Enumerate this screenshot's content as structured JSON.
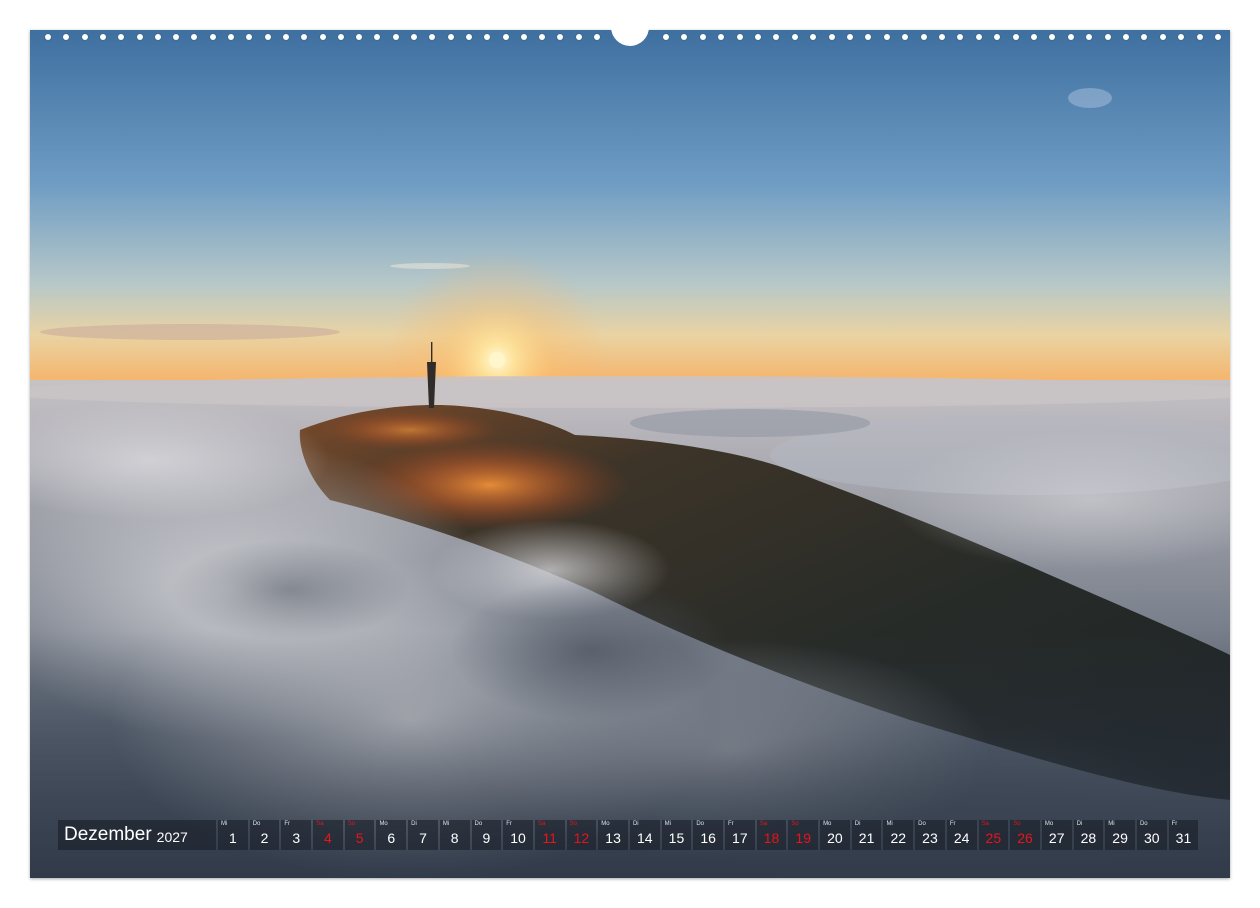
{
  "calendar": {
    "month": "Dezember",
    "year": "2027",
    "days": [
      {
        "weekday": "Mi",
        "date": "1",
        "holiday": false
      },
      {
        "weekday": "Do",
        "date": "2",
        "holiday": false
      },
      {
        "weekday": "Fr",
        "date": "3",
        "holiday": false
      },
      {
        "weekday": "Sa",
        "date": "4",
        "holiday": true
      },
      {
        "weekday": "So",
        "date": "5",
        "holiday": true
      },
      {
        "weekday": "Mo",
        "date": "6",
        "holiday": false
      },
      {
        "weekday": "Di",
        "date": "7",
        "holiday": false
      },
      {
        "weekday": "Mi",
        "date": "8",
        "holiday": false
      },
      {
        "weekday": "Do",
        "date": "9",
        "holiday": false
      },
      {
        "weekday": "Fr",
        "date": "10",
        "holiday": false
      },
      {
        "weekday": "Sa",
        "date": "11",
        "holiday": true
      },
      {
        "weekday": "So",
        "date": "12",
        "holiday": true
      },
      {
        "weekday": "Mo",
        "date": "13",
        "holiday": false
      },
      {
        "weekday": "Di",
        "date": "14",
        "holiday": false
      },
      {
        "weekday": "Mi",
        "date": "15",
        "holiday": false
      },
      {
        "weekday": "Do",
        "date": "16",
        "holiday": false
      },
      {
        "weekday": "Fr",
        "date": "17",
        "holiday": false
      },
      {
        "weekday": "Sa",
        "date": "18",
        "holiday": true
      },
      {
        "weekday": "So",
        "date": "19",
        "holiday": true
      },
      {
        "weekday": "Mo",
        "date": "20",
        "holiday": false
      },
      {
        "weekday": "Di",
        "date": "21",
        "holiday": false
      },
      {
        "weekday": "Mi",
        "date": "22",
        "holiday": false
      },
      {
        "weekday": "Do",
        "date": "23",
        "holiday": false
      },
      {
        "weekday": "Fr",
        "date": "24",
        "holiday": false
      },
      {
        "weekday": "Sa",
        "date": "25",
        "holiday": true
      },
      {
        "weekday": "So",
        "date": "26",
        "holiday": true
      },
      {
        "weekday": "Mo",
        "date": "27",
        "holiday": false
      },
      {
        "weekday": "Di",
        "date": "28",
        "holiday": false
      },
      {
        "weekday": "Mi",
        "date": "29",
        "holiday": false
      },
      {
        "weekday": "Do",
        "date": "30",
        "holiday": false
      },
      {
        "weekday": "Fr",
        "date": "31",
        "holiday": false
      }
    ]
  },
  "colors": {
    "holiday": "#e8141b",
    "strip_bg": "#191e28",
    "sky_top": "#4f7fb0",
    "sky_horizon": "#f4b770",
    "sun": "#fff3c0"
  },
  "icons": {
    "binding": "spiral-binding-holes",
    "hanger": "hanger-notch"
  }
}
